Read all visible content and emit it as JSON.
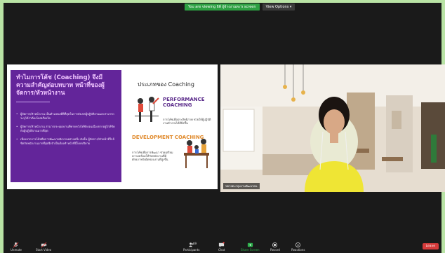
{
  "banner": {
    "notice": "You are viewing ธิติ่ ผู้จ้างงานทะ's screen",
    "view_options": "View Options ▾"
  },
  "slide": {
    "title": "ทำไมการโค้ช (Coaching) จึงมีความสำคัญต่อบทบาท หน้าที่ของผู้จัดการ/หัวหน้างาน",
    "bullets": [
      "ผู้จัดการ/หัวหน้างาน เป็นตำแหน่งที่ดีที่สุดในการสังเกตผู้ปฏิบัติงานและสามารถระบุได้ว่าต้องโคชเรื่องใด",
      "ผู้จัดการ/หัวหน้างาน สามารถระบุผลงานที่คาดหวังได้ชัดเจนเนื่องจากอยู่ใกล้ชิดกับผู้ปฏิบัติงานมากที่สุด",
      "เนื่องจากการโค้ชคือการพัฒนาพนักงานอย่างหนึ่ง ดังนั้น ผู้จัดการ/หัวหน้าที่ใกล้ชิดกับพนักงานมากที่สุดจึงจำเป็นต้องทำหน้าที่นี้โดยปริยาย"
    ],
    "right_title": "ประเภทของ Coaching",
    "performance": "PERFORMANCE COACHING",
    "performance_sub": "การโค้ชเพื่อประสิทธิภาพ ช่วยให้ผู้ปฏิบัติงานทำงานได้ดียิ่งขึ้น",
    "development": "DEVELOPMENT COACHING",
    "development_sub": "การโค้ชเพื่อการพัฒนา ช่วยเตรียมความพร้อมให้กับพนักงานที่มีศักยภาพรับผิดชอบงานที่สูงขึ้น"
  },
  "video": {
    "name": "ขยายตะกลุมงานพัฒนาคน"
  },
  "toolbar": {
    "unmute": "Unmute",
    "start_video": "Start Video",
    "participants": "Participants",
    "participants_count": "69",
    "chat": "Chat",
    "share_screen": "Share Screen",
    "record": "Record",
    "reactions": "Reactions",
    "leave": "Leave"
  },
  "colors": {
    "border": "#b9e3a5",
    "slide_purple": "#63259a",
    "notice_green": "#2da042",
    "leave_red": "#d63b3b",
    "share_green": "#2fb14d"
  }
}
